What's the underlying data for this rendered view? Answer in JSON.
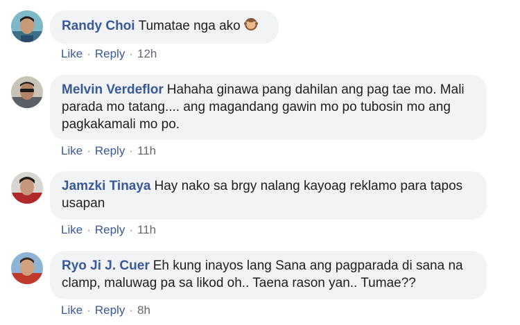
{
  "comments": [
    {
      "author": "Randy Choi",
      "text": "Tumatae nga ako",
      "emoji": "see-no-evil-monkey-icon",
      "like": "Like",
      "reply": "Reply",
      "time": "12h"
    },
    {
      "author": "Melvin Verdeflor",
      "text": "Hahaha ginawa pang dahilan ang pag tae mo. Mali parada mo tatang.... ang magandang gawin mo po tubosin mo ang pagkakamali mo po.",
      "like": "Like",
      "reply": "Reply",
      "time": "11h"
    },
    {
      "author": "Jamzki Tinaya",
      "text": "Hay nako sa brgy nalang kayoag reklamo para tapos usapan",
      "like": "Like",
      "reply": "Reply",
      "time": "11h"
    },
    {
      "author": "Ryo Ji J. Cuer",
      "text": "Eh kung inayos lang Sana ang pagparada di sana na clamp, maluwag pa sa likod oh.. Taena rason yan.. Tumae??",
      "like": "Like",
      "reply": "Reply",
      "time": "8h"
    }
  ],
  "separator": "·",
  "colors": {
    "author": "#385898",
    "bubble": "#f2f3f5",
    "text": "#1c1e21",
    "meta": "#616770"
  }
}
